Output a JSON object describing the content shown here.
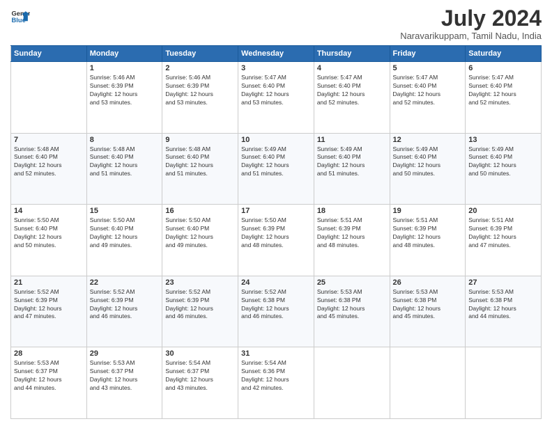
{
  "header": {
    "logo_line1": "General",
    "logo_line2": "Blue",
    "month_title": "July 2024",
    "location": "Naravarikuppam, Tamil Nadu, India"
  },
  "weekdays": [
    "Sunday",
    "Monday",
    "Tuesday",
    "Wednesday",
    "Thursday",
    "Friday",
    "Saturday"
  ],
  "weeks": [
    [
      {
        "day": "",
        "info": ""
      },
      {
        "day": "1",
        "info": "Sunrise: 5:46 AM\nSunset: 6:39 PM\nDaylight: 12 hours\nand 53 minutes."
      },
      {
        "day": "2",
        "info": "Sunrise: 5:46 AM\nSunset: 6:39 PM\nDaylight: 12 hours\nand 53 minutes."
      },
      {
        "day": "3",
        "info": "Sunrise: 5:47 AM\nSunset: 6:40 PM\nDaylight: 12 hours\nand 53 minutes."
      },
      {
        "day": "4",
        "info": "Sunrise: 5:47 AM\nSunset: 6:40 PM\nDaylight: 12 hours\nand 52 minutes."
      },
      {
        "day": "5",
        "info": "Sunrise: 5:47 AM\nSunset: 6:40 PM\nDaylight: 12 hours\nand 52 minutes."
      },
      {
        "day": "6",
        "info": "Sunrise: 5:47 AM\nSunset: 6:40 PM\nDaylight: 12 hours\nand 52 minutes."
      }
    ],
    [
      {
        "day": "7",
        "info": "Sunrise: 5:48 AM\nSunset: 6:40 PM\nDaylight: 12 hours\nand 52 minutes."
      },
      {
        "day": "8",
        "info": "Sunrise: 5:48 AM\nSunset: 6:40 PM\nDaylight: 12 hours\nand 51 minutes."
      },
      {
        "day": "9",
        "info": "Sunrise: 5:48 AM\nSunset: 6:40 PM\nDaylight: 12 hours\nand 51 minutes."
      },
      {
        "day": "10",
        "info": "Sunrise: 5:49 AM\nSunset: 6:40 PM\nDaylight: 12 hours\nand 51 minutes."
      },
      {
        "day": "11",
        "info": "Sunrise: 5:49 AM\nSunset: 6:40 PM\nDaylight: 12 hours\nand 51 minutes."
      },
      {
        "day": "12",
        "info": "Sunrise: 5:49 AM\nSunset: 6:40 PM\nDaylight: 12 hours\nand 50 minutes."
      },
      {
        "day": "13",
        "info": "Sunrise: 5:49 AM\nSunset: 6:40 PM\nDaylight: 12 hours\nand 50 minutes."
      }
    ],
    [
      {
        "day": "14",
        "info": "Sunrise: 5:50 AM\nSunset: 6:40 PM\nDaylight: 12 hours\nand 50 minutes."
      },
      {
        "day": "15",
        "info": "Sunrise: 5:50 AM\nSunset: 6:40 PM\nDaylight: 12 hours\nand 49 minutes."
      },
      {
        "day": "16",
        "info": "Sunrise: 5:50 AM\nSunset: 6:40 PM\nDaylight: 12 hours\nand 49 minutes."
      },
      {
        "day": "17",
        "info": "Sunrise: 5:50 AM\nSunset: 6:39 PM\nDaylight: 12 hours\nand 48 minutes."
      },
      {
        "day": "18",
        "info": "Sunrise: 5:51 AM\nSunset: 6:39 PM\nDaylight: 12 hours\nand 48 minutes."
      },
      {
        "day": "19",
        "info": "Sunrise: 5:51 AM\nSunset: 6:39 PM\nDaylight: 12 hours\nand 48 minutes."
      },
      {
        "day": "20",
        "info": "Sunrise: 5:51 AM\nSunset: 6:39 PM\nDaylight: 12 hours\nand 47 minutes."
      }
    ],
    [
      {
        "day": "21",
        "info": "Sunrise: 5:52 AM\nSunset: 6:39 PM\nDaylight: 12 hours\nand 47 minutes."
      },
      {
        "day": "22",
        "info": "Sunrise: 5:52 AM\nSunset: 6:39 PM\nDaylight: 12 hours\nand 46 minutes."
      },
      {
        "day": "23",
        "info": "Sunrise: 5:52 AM\nSunset: 6:39 PM\nDaylight: 12 hours\nand 46 minutes."
      },
      {
        "day": "24",
        "info": "Sunrise: 5:52 AM\nSunset: 6:38 PM\nDaylight: 12 hours\nand 46 minutes."
      },
      {
        "day": "25",
        "info": "Sunrise: 5:53 AM\nSunset: 6:38 PM\nDaylight: 12 hours\nand 45 minutes."
      },
      {
        "day": "26",
        "info": "Sunrise: 5:53 AM\nSunset: 6:38 PM\nDaylight: 12 hours\nand 45 minutes."
      },
      {
        "day": "27",
        "info": "Sunrise: 5:53 AM\nSunset: 6:38 PM\nDaylight: 12 hours\nand 44 minutes."
      }
    ],
    [
      {
        "day": "28",
        "info": "Sunrise: 5:53 AM\nSunset: 6:37 PM\nDaylight: 12 hours\nand 44 minutes."
      },
      {
        "day": "29",
        "info": "Sunrise: 5:53 AM\nSunset: 6:37 PM\nDaylight: 12 hours\nand 43 minutes."
      },
      {
        "day": "30",
        "info": "Sunrise: 5:54 AM\nSunset: 6:37 PM\nDaylight: 12 hours\nand 43 minutes."
      },
      {
        "day": "31",
        "info": "Sunrise: 5:54 AM\nSunset: 6:36 PM\nDaylight: 12 hours\nand 42 minutes."
      },
      {
        "day": "",
        "info": ""
      },
      {
        "day": "",
        "info": ""
      },
      {
        "day": "",
        "info": ""
      }
    ]
  ]
}
